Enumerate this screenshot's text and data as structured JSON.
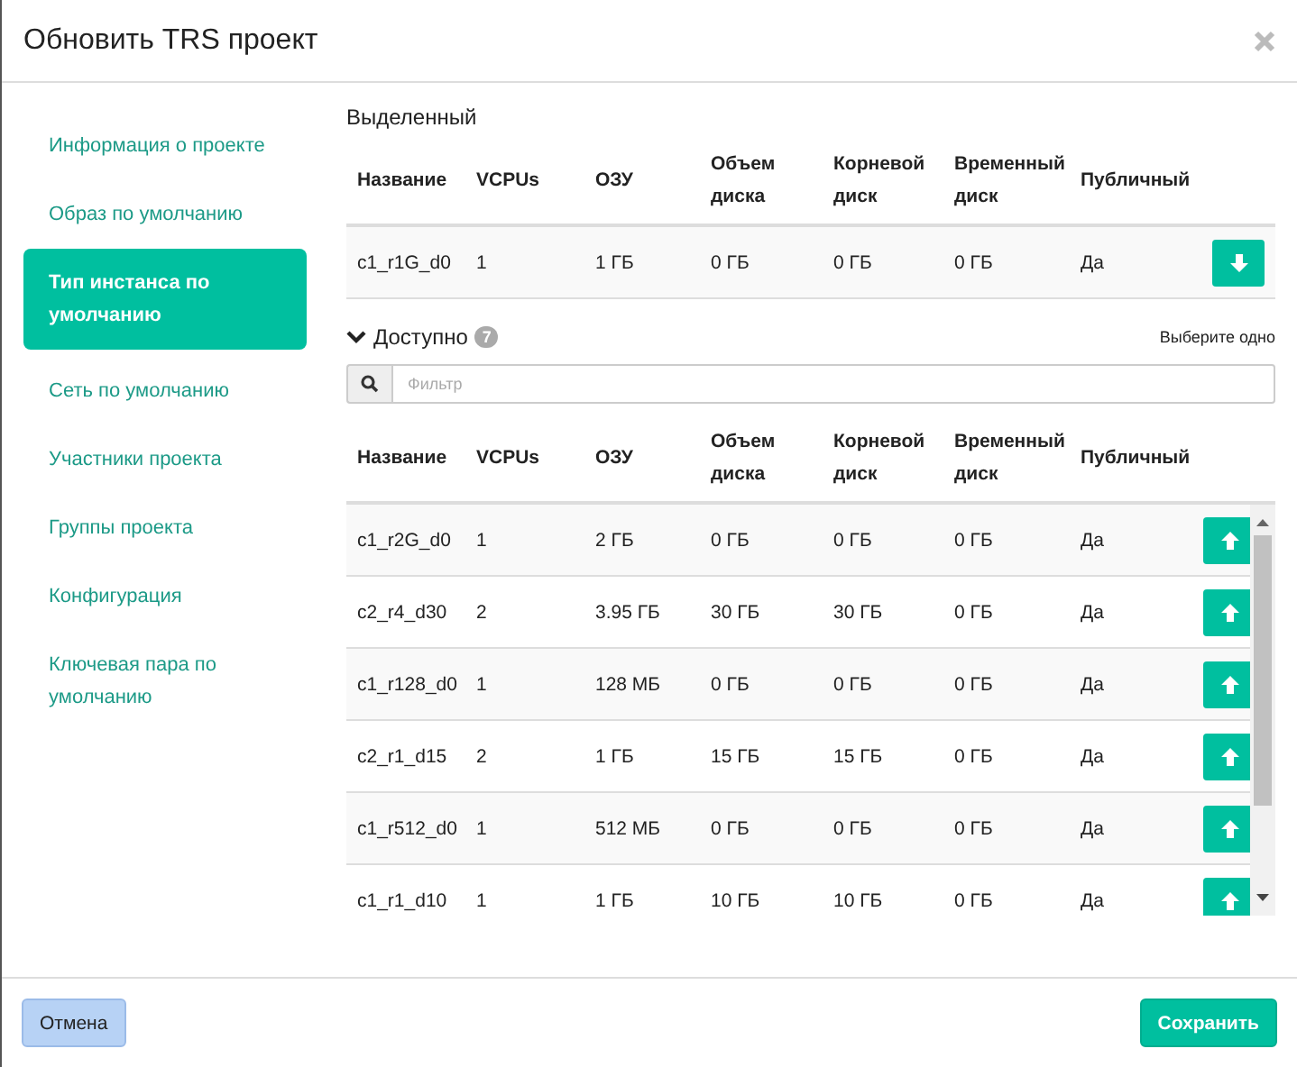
{
  "window": {
    "title": "Обновить TRS проект"
  },
  "sidebar": {
    "items": [
      {
        "label": "Информация о проекте",
        "selected": false
      },
      {
        "label": "Образ по умолчанию",
        "selected": false
      },
      {
        "label": "Тип инстанса по умолчанию",
        "selected": true
      },
      {
        "label": "Сеть по умолчанию",
        "selected": false
      },
      {
        "label": "Участники проекта",
        "selected": false
      },
      {
        "label": "Группы проекта",
        "selected": false
      },
      {
        "label": "Конфигурация",
        "selected": false
      },
      {
        "label": "Ключевая пара по умолчанию",
        "selected": false
      }
    ]
  },
  "allocated": {
    "title": "Выделенный",
    "columns": [
      "Название",
      "VCPUs",
      "ОЗУ",
      "Объем диска",
      "Корневой диск",
      "Временный диск",
      "Публичный"
    ],
    "rows": [
      {
        "cells": [
          "c1_r1G_d0",
          "1",
          "1 ГБ",
          "0 ГБ",
          "0 ГБ",
          "0 ГБ",
          "Да"
        ]
      }
    ]
  },
  "available": {
    "title": "Доступно",
    "count": "7",
    "hint": "Выберите одно",
    "filter": {
      "placeholder": "Фильтр"
    },
    "columns": [
      "Название",
      "VCPUs",
      "ОЗУ",
      "Объем диска",
      "Корневой диск",
      "Временный диск",
      "Публичный"
    ],
    "rows": [
      {
        "cells": [
          "c1_r2G_d0",
          "1",
          "2 ГБ",
          "0 ГБ",
          "0 ГБ",
          "0 ГБ",
          "Да"
        ]
      },
      {
        "cells": [
          "c2_r4_d30",
          "2",
          "3.95 ГБ",
          "30 ГБ",
          "30 ГБ",
          "0 ГБ",
          "Да"
        ]
      },
      {
        "cells": [
          "c1_r128_d0",
          "1",
          "128 МБ",
          "0 ГБ",
          "0 ГБ",
          "0 ГБ",
          "Да"
        ]
      },
      {
        "cells": [
          "c2_r1_d15",
          "2",
          "1 ГБ",
          "15 ГБ",
          "15 ГБ",
          "0 ГБ",
          "Да"
        ]
      },
      {
        "cells": [
          "c1_r512_d0",
          "1",
          "512 МБ",
          "0 ГБ",
          "0 ГБ",
          "0 ГБ",
          "Да"
        ]
      },
      {
        "cells": [
          "c1_r1_d10",
          "1",
          "1 ГБ",
          "10 ГБ",
          "10 ГБ",
          "0 ГБ",
          "Да"
        ]
      }
    ]
  },
  "footer": {
    "cancel": "Отмена",
    "save": "Сохранить"
  }
}
